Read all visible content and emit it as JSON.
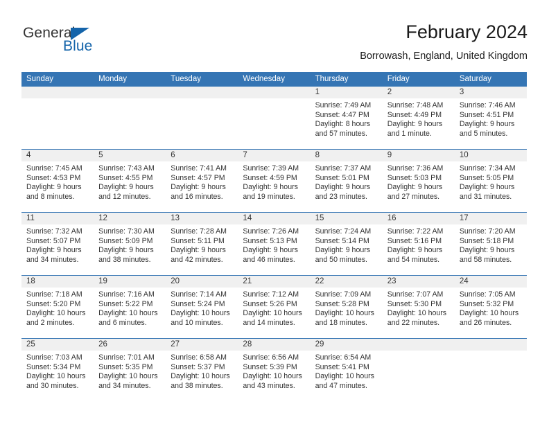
{
  "logo": {
    "word_one": "General",
    "word_two": "Blue",
    "triangle_icon": "blue-triangle-icon",
    "blue": "#1464aa"
  },
  "header": {
    "title": "February 2024",
    "subtitle": "Borrowash, England, United Kingdom"
  },
  "theme": {
    "header_blue": "#3575b4",
    "date_band": "#f0f0f0",
    "text": "#333333"
  },
  "weekdays": [
    "Sunday",
    "Monday",
    "Tuesday",
    "Wednesday",
    "Thursday",
    "Friday",
    "Saturday"
  ],
  "weeks": [
    [
      {
        "day": "",
        "lines": []
      },
      {
        "day": "",
        "lines": []
      },
      {
        "day": "",
        "lines": []
      },
      {
        "day": "",
        "lines": []
      },
      {
        "day": "1",
        "lines": [
          "Sunrise: 7:49 AM",
          "Sunset: 4:47 PM",
          "Daylight: 8 hours",
          "and 57 minutes."
        ]
      },
      {
        "day": "2",
        "lines": [
          "Sunrise: 7:48 AM",
          "Sunset: 4:49 PM",
          "Daylight: 9 hours",
          "and 1 minute."
        ]
      },
      {
        "day": "3",
        "lines": [
          "Sunrise: 7:46 AM",
          "Sunset: 4:51 PM",
          "Daylight: 9 hours",
          "and 5 minutes."
        ]
      }
    ],
    [
      {
        "day": "4",
        "lines": [
          "Sunrise: 7:45 AM",
          "Sunset: 4:53 PM",
          "Daylight: 9 hours",
          "and 8 minutes."
        ]
      },
      {
        "day": "5",
        "lines": [
          "Sunrise: 7:43 AM",
          "Sunset: 4:55 PM",
          "Daylight: 9 hours",
          "and 12 minutes."
        ]
      },
      {
        "day": "6",
        "lines": [
          "Sunrise: 7:41 AM",
          "Sunset: 4:57 PM",
          "Daylight: 9 hours",
          "and 16 minutes."
        ]
      },
      {
        "day": "7",
        "lines": [
          "Sunrise: 7:39 AM",
          "Sunset: 4:59 PM",
          "Daylight: 9 hours",
          "and 19 minutes."
        ]
      },
      {
        "day": "8",
        "lines": [
          "Sunrise: 7:37 AM",
          "Sunset: 5:01 PM",
          "Daylight: 9 hours",
          "and 23 minutes."
        ]
      },
      {
        "day": "9",
        "lines": [
          "Sunrise: 7:36 AM",
          "Sunset: 5:03 PM",
          "Daylight: 9 hours",
          "and 27 minutes."
        ]
      },
      {
        "day": "10",
        "lines": [
          "Sunrise: 7:34 AM",
          "Sunset: 5:05 PM",
          "Daylight: 9 hours",
          "and 31 minutes."
        ]
      }
    ],
    [
      {
        "day": "11",
        "lines": [
          "Sunrise: 7:32 AM",
          "Sunset: 5:07 PM",
          "Daylight: 9 hours",
          "and 34 minutes."
        ]
      },
      {
        "day": "12",
        "lines": [
          "Sunrise: 7:30 AM",
          "Sunset: 5:09 PM",
          "Daylight: 9 hours",
          "and 38 minutes."
        ]
      },
      {
        "day": "13",
        "lines": [
          "Sunrise: 7:28 AM",
          "Sunset: 5:11 PM",
          "Daylight: 9 hours",
          "and 42 minutes."
        ]
      },
      {
        "day": "14",
        "lines": [
          "Sunrise: 7:26 AM",
          "Sunset: 5:13 PM",
          "Daylight: 9 hours",
          "and 46 minutes."
        ]
      },
      {
        "day": "15",
        "lines": [
          "Sunrise: 7:24 AM",
          "Sunset: 5:14 PM",
          "Daylight: 9 hours",
          "and 50 minutes."
        ]
      },
      {
        "day": "16",
        "lines": [
          "Sunrise: 7:22 AM",
          "Sunset: 5:16 PM",
          "Daylight: 9 hours",
          "and 54 minutes."
        ]
      },
      {
        "day": "17",
        "lines": [
          "Sunrise: 7:20 AM",
          "Sunset: 5:18 PM",
          "Daylight: 9 hours",
          "and 58 minutes."
        ]
      }
    ],
    [
      {
        "day": "18",
        "lines": [
          "Sunrise: 7:18 AM",
          "Sunset: 5:20 PM",
          "Daylight: 10 hours",
          "and 2 minutes."
        ]
      },
      {
        "day": "19",
        "lines": [
          "Sunrise: 7:16 AM",
          "Sunset: 5:22 PM",
          "Daylight: 10 hours",
          "and 6 minutes."
        ]
      },
      {
        "day": "20",
        "lines": [
          "Sunrise: 7:14 AM",
          "Sunset: 5:24 PM",
          "Daylight: 10 hours",
          "and 10 minutes."
        ]
      },
      {
        "day": "21",
        "lines": [
          "Sunrise: 7:12 AM",
          "Sunset: 5:26 PM",
          "Daylight: 10 hours",
          "and 14 minutes."
        ]
      },
      {
        "day": "22",
        "lines": [
          "Sunrise: 7:09 AM",
          "Sunset: 5:28 PM",
          "Daylight: 10 hours",
          "and 18 minutes."
        ]
      },
      {
        "day": "23",
        "lines": [
          "Sunrise: 7:07 AM",
          "Sunset: 5:30 PM",
          "Daylight: 10 hours",
          "and 22 minutes."
        ]
      },
      {
        "day": "24",
        "lines": [
          "Sunrise: 7:05 AM",
          "Sunset: 5:32 PM",
          "Daylight: 10 hours",
          "and 26 minutes."
        ]
      }
    ],
    [
      {
        "day": "25",
        "lines": [
          "Sunrise: 7:03 AM",
          "Sunset: 5:34 PM",
          "Daylight: 10 hours",
          "and 30 minutes."
        ]
      },
      {
        "day": "26",
        "lines": [
          "Sunrise: 7:01 AM",
          "Sunset: 5:35 PM",
          "Daylight: 10 hours",
          "and 34 minutes."
        ]
      },
      {
        "day": "27",
        "lines": [
          "Sunrise: 6:58 AM",
          "Sunset: 5:37 PM",
          "Daylight: 10 hours",
          "and 38 minutes."
        ]
      },
      {
        "day": "28",
        "lines": [
          "Sunrise: 6:56 AM",
          "Sunset: 5:39 PM",
          "Daylight: 10 hours",
          "and 43 minutes."
        ]
      },
      {
        "day": "29",
        "lines": [
          "Sunrise: 6:54 AM",
          "Sunset: 5:41 PM",
          "Daylight: 10 hours",
          "and 47 minutes."
        ]
      },
      {
        "day": "",
        "lines": []
      },
      {
        "day": "",
        "lines": []
      }
    ]
  ]
}
